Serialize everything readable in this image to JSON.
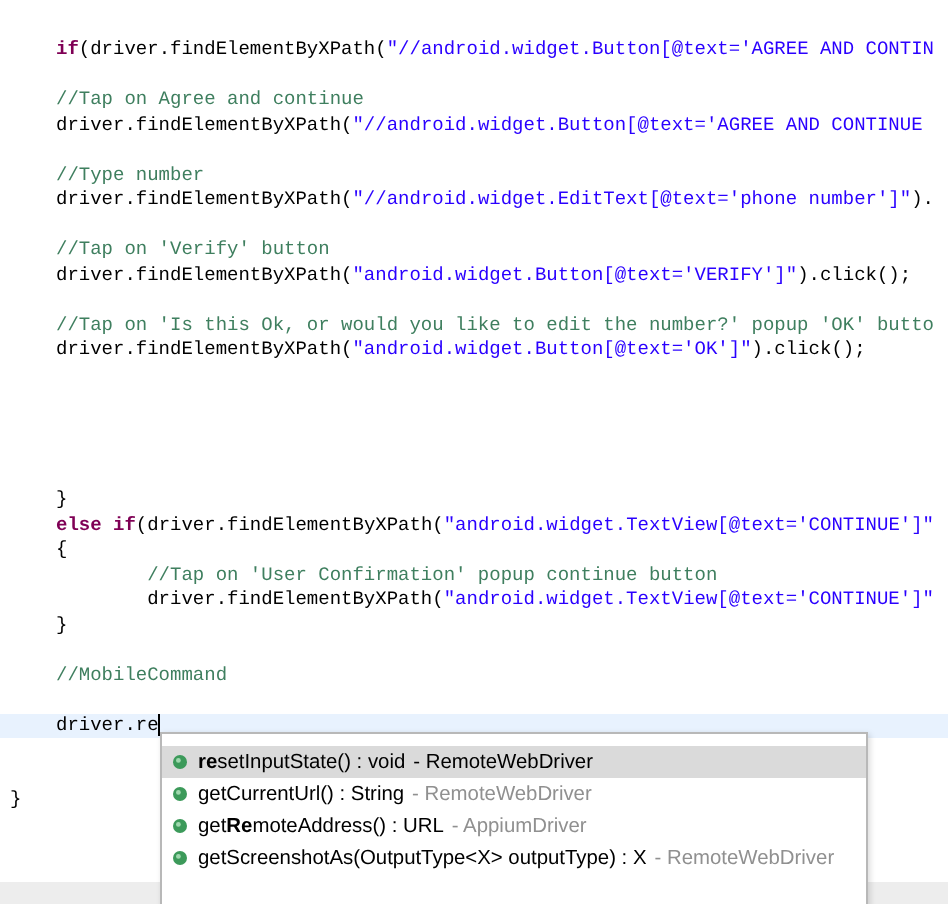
{
  "editor": {
    "lines": [
      {
        "kind": "code",
        "tokens": [
          {
            "kind": "keyword",
            "text": "if"
          },
          {
            "kind": "plain",
            "text": "(driver.findElementByXPath("
          },
          {
            "kind": "string",
            "text": "\"//android.widget.Button[@text='AGREE AND CONTIN"
          }
        ]
      },
      {
        "kind": "blank"
      },
      {
        "kind": "code",
        "tokens": [
          {
            "kind": "comment",
            "text": "//Tap on Agree and continue"
          }
        ]
      },
      {
        "kind": "code",
        "tokens": [
          {
            "kind": "plain",
            "text": "driver.findElementByXPath("
          },
          {
            "kind": "string",
            "text": "\"//android.widget.Button[@text='AGREE AND CONTINUE"
          }
        ]
      },
      {
        "kind": "blank"
      },
      {
        "kind": "code",
        "tokens": [
          {
            "kind": "comment",
            "text": "//Type number"
          }
        ]
      },
      {
        "kind": "code",
        "tokens": [
          {
            "kind": "plain",
            "text": "driver.findElementByXPath("
          },
          {
            "kind": "string",
            "text": "\"//android.widget.EditText[@text='phone number']\""
          },
          {
            "kind": "plain",
            "text": ")."
          }
        ]
      },
      {
        "kind": "blank"
      },
      {
        "kind": "code",
        "tokens": [
          {
            "kind": "comment",
            "text": "//Tap on 'Verify' button"
          }
        ]
      },
      {
        "kind": "code",
        "tokens": [
          {
            "kind": "plain",
            "text": "driver.findElementByXPath("
          },
          {
            "kind": "string",
            "text": "\"android.widget.Button[@text='VERIFY']\""
          },
          {
            "kind": "plain",
            "text": ").click();"
          }
        ]
      },
      {
        "kind": "blank"
      },
      {
        "kind": "code",
        "tokens": [
          {
            "kind": "comment",
            "text": "//Tap on 'Is this Ok, or would you like to edit the number?' popup 'OK' butto"
          }
        ]
      },
      {
        "kind": "code",
        "tokens": [
          {
            "kind": "plain",
            "text": "driver.findElementByXPath("
          },
          {
            "kind": "string",
            "text": "\"android.widget.Button[@text='OK']\""
          },
          {
            "kind": "plain",
            "text": ").click();"
          }
        ]
      },
      {
        "kind": "blank"
      },
      {
        "kind": "blank"
      },
      {
        "kind": "blank"
      },
      {
        "kind": "blank"
      },
      {
        "kind": "blank"
      },
      {
        "kind": "code",
        "tokens": [
          {
            "kind": "plain",
            "text": "}"
          }
        ]
      },
      {
        "kind": "code",
        "tokens": [
          {
            "kind": "keyword",
            "text": "else if"
          },
          {
            "kind": "plain",
            "text": "(driver.findElementByXPath("
          },
          {
            "kind": "string",
            "text": "\"android.widget.TextView[@text='CONTINUE']\""
          }
        ]
      },
      {
        "kind": "code",
        "tokens": [
          {
            "kind": "plain",
            "text": "{"
          }
        ]
      },
      {
        "kind": "code",
        "tokens": [
          {
            "kind": "comment",
            "text": "        //Tap on 'User Confirmation' popup continue button"
          }
        ]
      },
      {
        "kind": "code",
        "tokens": [
          {
            "kind": "plain",
            "text": "        driver.findElementByXPath("
          },
          {
            "kind": "string",
            "text": "\"android.widget.TextView[@text='CONTINUE']\""
          }
        ]
      },
      {
        "kind": "code",
        "tokens": [
          {
            "kind": "plain",
            "text": "}"
          }
        ]
      },
      {
        "kind": "blank"
      },
      {
        "kind": "code",
        "tokens": [
          {
            "kind": "comment",
            "text": "//MobileCommand"
          }
        ]
      },
      {
        "kind": "blank"
      },
      {
        "kind": "current",
        "tokens": [
          {
            "kind": "plain",
            "text": "driver.re"
          }
        ]
      },
      {
        "kind": "blank"
      },
      {
        "kind": "blank"
      },
      {
        "kind": "outer",
        "tokens": [
          {
            "kind": "plain",
            "text": "}"
          }
        ]
      }
    ]
  },
  "completion": {
    "items": [
      {
        "signature": "**re**setInputState() : void",
        "qualifier": "- RemoteWebDriver",
        "selected": true
      },
      {
        "signature": "getCurrentUrl() : String",
        "qualifier": "- RemoteWebDriver",
        "selected": false
      },
      {
        "signature": "get**Re**moteAddress() : URL",
        "qualifier": "- AppiumDriver",
        "selected": false
      },
      {
        "signature": "getScreenshotAs(OutputType<X> outputType) : X",
        "qualifier": "- RemoteWebDriver",
        "selected": false
      }
    ]
  }
}
